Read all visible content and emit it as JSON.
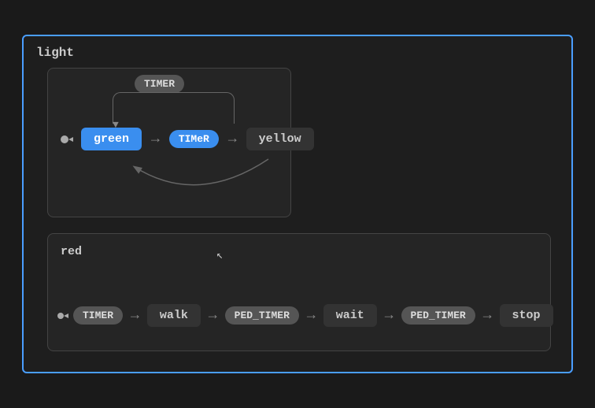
{
  "diagram": {
    "title": "light",
    "top_region": {
      "self_timer_label": "TIMER",
      "green_state": "green",
      "timer_blue_label": "TIMeR",
      "yellow_state": "yellow"
    },
    "bottom_region": {
      "red_label": "red",
      "timer_label": "TIMER",
      "walk_state": "walk",
      "ped_timer1": "PED_TIMER",
      "wait_state": "wait",
      "ped_timer2": "PED_TIMER",
      "stop_state": "stop"
    }
  },
  "icons": {
    "arrow_right": "→",
    "initial_marker": "⌐",
    "cursor": "⬆"
  }
}
